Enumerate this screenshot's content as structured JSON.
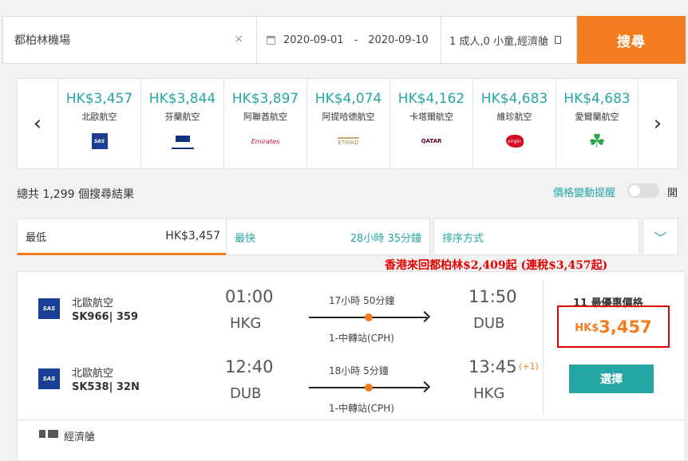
{
  "search": {
    "destination": "都柏林機場",
    "clear_icon": "×",
    "date_from": "2020-09-01",
    "date_sep": "-",
    "date_to": "2020-09-10",
    "passengers": "1 成人,0 小童,經濟艙",
    "search_label": "搜尋"
  },
  "carousel": {
    "prev": "‹",
    "next": "›",
    "airlines": [
      {
        "price": "HK$3,457",
        "name": "北歐航空",
        "logo": "SAS"
      },
      {
        "price": "HK$3,844",
        "name": "芬蘭航空",
        "logo": "FINNAIR"
      },
      {
        "price": "HK$3,897",
        "name": "阿聯酋航空",
        "logo": "Emirates"
      },
      {
        "price": "HK$4,074",
        "name": "阿提哈德航空",
        "logo": "ETIHAD"
      },
      {
        "price": "HK$4,162",
        "name": "卡塔爾航空",
        "logo": "QATAR"
      },
      {
        "price": "HK$4,683",
        "name": "維珍航空",
        "logo": "virgin"
      },
      {
        "price": "HK$4,683",
        "name": "愛爾蘭航空",
        "logo": "☘"
      }
    ]
  },
  "results": {
    "total": "總共 1,299 個搜尋結果",
    "price_alert": "價格變動提醒",
    "toggle_label": "開"
  },
  "sort": {
    "cheapest_label": "最低",
    "cheapest_value": "HK$3,457",
    "fastest_label": "最快",
    "fastest_value": "28小時 35分鐘",
    "sort_by_label": "排序方式",
    "expand_icon": "﹀"
  },
  "promo": "香港來回都柏林$2,409起 (連稅$3,457起)",
  "card": {
    "legs": [
      {
        "logo": "SAS",
        "airline": "北歐航空",
        "flight": "SK966| 359",
        "dep_time": "01:00",
        "dep_code": "HKG",
        "duration": "17小時 50分鐘",
        "stops": "1-中轉站(CPH)",
        "arr_time": "11:50",
        "arr_code": "DUB",
        "day_offset": ""
      },
      {
        "logo": "SAS",
        "airline": "北歐航空",
        "flight": "SK538| 32N",
        "dep_time": "12:40",
        "dep_code": "DUB",
        "duration": "18小時 5分鐘",
        "stops": "1-中轉站(CPH)",
        "arr_time": "13:45",
        "arr_code": "HKG",
        "day_offset": "(+1)"
      }
    ],
    "deals": "11 最優惠價格",
    "currency": "HK$",
    "price": "3,457",
    "select_label": "選擇",
    "cabin": "經濟艙"
  },
  "colors": {
    "accent": "#f47c20",
    "teal": "#26a5a5",
    "highlight": "#e00000"
  }
}
